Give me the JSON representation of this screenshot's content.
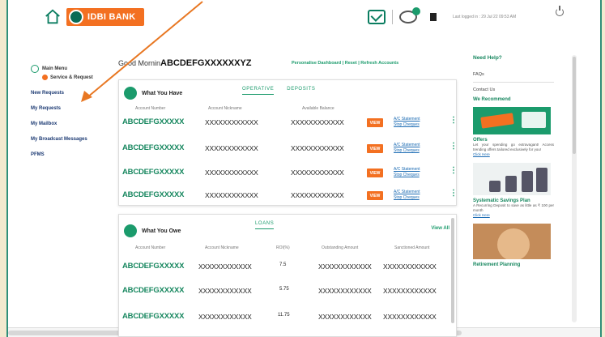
{
  "header": {
    "bank_name": "IDBI BANK",
    "last_login": "Last logged in : 29 Jul 22 09:53 AM"
  },
  "sidebar": {
    "main_menu": "Main Menu",
    "service_request": "Service & Request",
    "items": [
      "New Requests",
      "My Requests",
      "My Mailbox",
      "My Broadcast Messages",
      "PFMS"
    ]
  },
  "greeting": {
    "prefix": "Good Mornin",
    "name": "ABCDEFGXXXXXXYZ"
  },
  "top_links": "Personalise Dashboard | Reset | Refresh Accounts",
  "have_card": {
    "title": "What You Have",
    "tabs": [
      "OPERATIVE",
      "DEPOSITS"
    ],
    "columns": [
      "Account Number",
      "Account Nickname",
      "Available Balance"
    ],
    "rows": [
      {
        "account": "ABCDEFGXXXXX",
        "nickname": "XXXXXXXXXXXX",
        "balance": "XXXXXXXXXXXX",
        "view": "VIEW",
        "link1": "A/C Statement",
        "link2": "Stop Cheques"
      },
      {
        "account": "ABCDEFGXXXXX",
        "nickname": "XXXXXXXXXXXX",
        "balance": "XXXXXXXXXXXX",
        "view": "VIEW",
        "link1": "A/C Statement",
        "link2": "Stop Cheques"
      },
      {
        "account": "ABCDEFGXXXXX",
        "nickname": "XXXXXXXXXXXX",
        "balance": "XXXXXXXXXXXX",
        "view": "VIEW",
        "link1": "A/C Statement",
        "link2": "Stop Cheques"
      },
      {
        "account": "ABCDEFGXXXXX",
        "nickname": "XXXXXXXXXXXX",
        "balance": "XXXXXXXXXXXX",
        "view": "VIEW",
        "link1": "A/C Statement",
        "link2": "Stop Cheques"
      }
    ]
  },
  "owe_card": {
    "title": "What You Owe",
    "tab": "LOANS",
    "view_all": "View All",
    "columns": [
      "Account Number",
      "Account Nickname",
      "ROI(%)",
      "Outstanding Amount",
      "Sanctioned Amount"
    ],
    "rows": [
      {
        "account": "ABCDEFGXXXXX",
        "nickname": "XXXXXXXXXXXX",
        "roi": "7.5",
        "outstanding": "XXXXXXXXXXXX",
        "sanctioned": "XXXXXXXXXXXX"
      },
      {
        "account": "ABCDEFGXXXXX",
        "nickname": "XXXXXXXXXXXX",
        "roi": "5.75",
        "outstanding": "XXXXXXXXXXXX",
        "sanctioned": "XXXXXXXXXXXX"
      },
      {
        "account": "ABCDEFGXXXXX",
        "nickname": "XXXXXXXXXXXX",
        "roi": "11.75",
        "outstanding": "XXXXXXXXXXXX",
        "sanctioned": "XXXXXXXXXXXX"
      }
    ]
  },
  "right_panel": {
    "need_help": "Need Help?",
    "faqs": "FAQs",
    "contact": "Contact Us",
    "recommend": "We Recommend",
    "offers_title": "Offers",
    "offers_text": "Let your spending go extravagant! Access trending offers tailored exclusively for you!",
    "click_here": "Click Here",
    "ssp_title": "Systematic Savings Plan",
    "ssp_text": "A Recurring Deposit to save as little as ₹ 100 per month",
    "retire_title": "Retirement Planning"
  },
  "colors": {
    "accent": "#1b9b6c",
    "brand_orange": "#f37021",
    "arrow": "#e87722"
  },
  "icons": [
    "home-icon",
    "mail-icon",
    "chat-icon",
    "user-icon",
    "power-icon",
    "kebab-icon"
  ]
}
